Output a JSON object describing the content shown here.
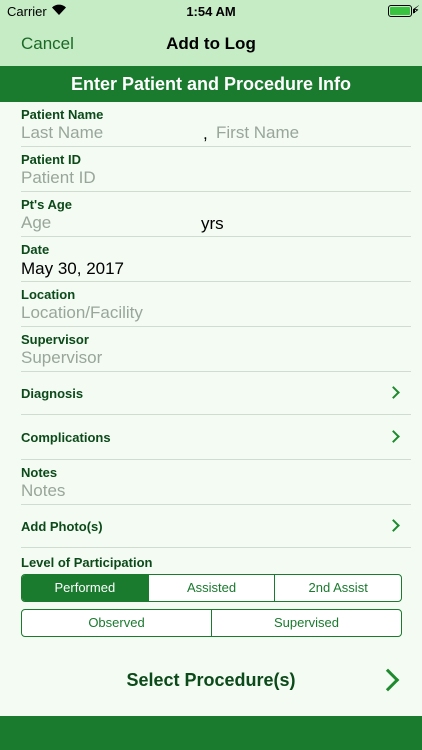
{
  "status": {
    "carrier": "Carrier",
    "time": "1:54 AM",
    "battery_percent": 100
  },
  "nav": {
    "cancel": "Cancel",
    "title": "Add to Log"
  },
  "header": {
    "title": "Enter Patient and Procedure Info"
  },
  "patient_name": {
    "label": "Patient Name",
    "last_placeholder": "Last Name",
    "separator": ",",
    "first_placeholder": "First Name"
  },
  "patient_id": {
    "label": "Patient ID",
    "placeholder": "Patient ID"
  },
  "age": {
    "label": "Pt's Age",
    "placeholder": "Age",
    "unit": "yrs"
  },
  "date": {
    "label": "Date",
    "value": "May 30, 2017"
  },
  "location": {
    "label": "Location",
    "placeholder": "Location/Facility"
  },
  "supervisor": {
    "label": "Supervisor",
    "placeholder": "Supervisor"
  },
  "diagnosis": {
    "label": "Diagnosis"
  },
  "complications": {
    "label": "Complications"
  },
  "notes": {
    "label": "Notes",
    "placeholder": "Notes"
  },
  "photos": {
    "label": "Add Photo(s)"
  },
  "participation": {
    "label": "Level of Participation",
    "row1": [
      "Performed",
      "Assisted",
      "2nd Assist"
    ],
    "row2": [
      "Observed",
      "Supervised"
    ],
    "selected": "Performed"
  },
  "select_procedure": {
    "label": "Select Procedure(s)"
  }
}
